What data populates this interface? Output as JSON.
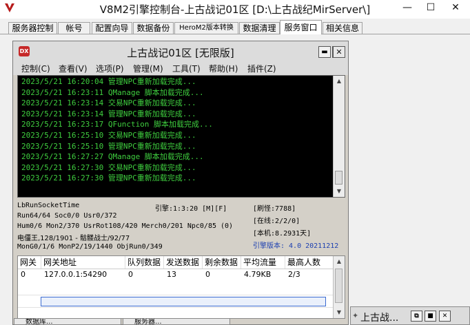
{
  "window": {
    "title": "V8M2引擎控制台-上古战记01区 [D:\\上古战纪MirServer\\]",
    "controls": {
      "minimize": "—",
      "maximize": "☐",
      "close": "✕"
    }
  },
  "tabs": [
    {
      "label": "服务器控制"
    },
    {
      "label": "帐号"
    },
    {
      "label": "配置向导"
    },
    {
      "label": "数据备份"
    },
    {
      "label": "HeroM2版本转换"
    },
    {
      "label": "数据清理"
    },
    {
      "label": "服务窗口"
    },
    {
      "label": "相关信息"
    }
  ],
  "active_tab": "服务窗口",
  "child": {
    "icon_text": "DX",
    "title": "上古战记01区 [无限版]",
    "controls": {
      "minimize": "▬",
      "maximize": "■",
      "close": "✕"
    },
    "menu": [
      {
        "label": "控制(C)"
      },
      {
        "label": "查看(V)"
      },
      {
        "label": "选项(P)"
      },
      {
        "label": "管理(M)"
      },
      {
        "label": "工具(T)"
      },
      {
        "label": "帮助(H)"
      },
      {
        "label": "插件(Z)"
      }
    ],
    "log": [
      "2023/5/21 16:20:04 管理NPC重新加载完成...",
      "2023/5/21 16:23:11 QManage 脚本加载完成...",
      "2023/5/21 16:23:14 交易NPC重新加载完成...",
      "2023/5/21 16:23:14 管理NPC重新加载完成...",
      "2023/5/21 16:23:17 QFunction 脚本加载完成...",
      "2023/5/21 16:25:10 交易NPC重新加载完成...",
      "2023/5/21 16:25:10 管理NPC重新加载完成...",
      "2023/5/21 16:27:27 QManage 脚本加载完成...",
      "2023/5/21 16:27:30 交易NPC重新加载完成...",
      "2023/5/21 16:27:30 管理NPC重新加载完成..."
    ],
    "status": {
      "line1": "LbRunSocketTime",
      "engine": "引擎:1:3:20 [M][F]",
      "refresh_monsters": "[刷怪:7788]",
      "line2": "Run64/64 Soc0/0 Usr0/372",
      "online": "[在线:2/2/0]",
      "line3": "Hum0/6 Mon2/370 UsrRot108/420 Merch0/201 Npc0/85 (0)",
      "uptime": "[本机:8.2931天]",
      "line4": "电僵王,128/1901 - 骷髅战士/92/77",
      "engine_version": "引擎版本: 4.0 20211212",
      "line5": "MonG0/1/6 MonP2/19/1440 ObjRun0/349"
    },
    "gateway": {
      "headers": [
        "网关",
        "网关地址",
        "队列数据",
        "发送数据",
        "剩余数据",
        "平均流量",
        "最高人数"
      ],
      "rows": [
        [
          "0",
          "127.0.0.1:54290",
          "0",
          "13",
          "0",
          "4.79KB",
          "2/3"
        ]
      ]
    }
  },
  "mdi_minimized": {
    "title": "上古战...",
    "controls": {
      "restore": "⧉",
      "maximize": "■",
      "close": "✕"
    },
    "left_items": [
      "数据库...",
      "服务器..."
    ]
  }
}
